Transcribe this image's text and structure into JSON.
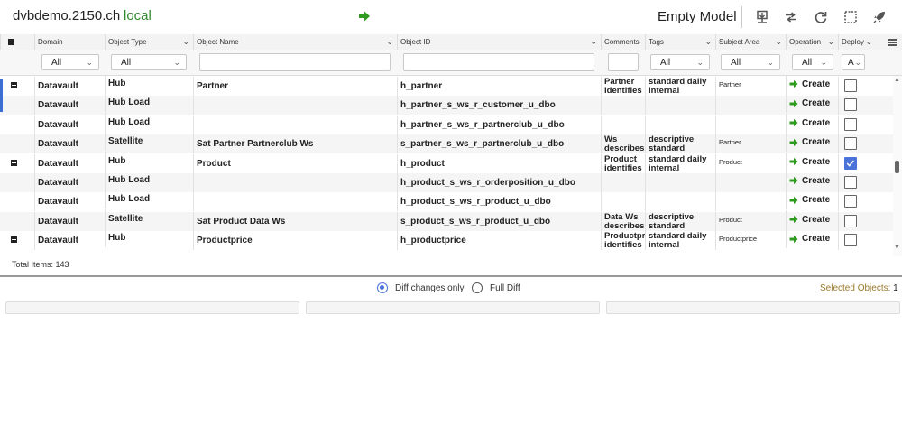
{
  "header": {
    "host": "dvbdemo.2150.ch",
    "environment": "local",
    "model": "Empty Model"
  },
  "colors": {
    "accent": "#4a73d9",
    "env_green": "#2e8b2e",
    "create_arrow": "#2e9a1f",
    "selected_label": "#9a7a2a"
  },
  "grid": {
    "columns": [
      "Domain",
      "Object Type",
      "Object Name",
      "Object ID",
      "Comments",
      "Tags",
      "Subject Area",
      "Operation",
      "Deploy"
    ],
    "filters": {
      "domain": "All",
      "object_type": "All",
      "object_name": "",
      "object_id": "",
      "comments": "",
      "tags": "All",
      "subject_area": "All",
      "operation": "All",
      "deploy": "A"
    },
    "rows": [
      {
        "expander": true,
        "domain": "Datavault",
        "object_type": "Hub",
        "object_name": "Partner",
        "object_id": "h_partner",
        "comments": "Partner identifies",
        "tags": "standard daily internal",
        "subject_area": "Partner",
        "operation": "Create",
        "deploy": false
      },
      {
        "expander": false,
        "domain": "Datavault",
        "object_type": "Hub Load",
        "object_name": "",
        "object_id": "h_partner_s_ws_r_customer_u_dbo",
        "comments": "",
        "tags": "",
        "subject_area": "",
        "operation": "Create",
        "deploy": false
      },
      {
        "expander": false,
        "domain": "Datavault",
        "object_type": "Hub Load",
        "object_name": "",
        "object_id": "h_partner_s_ws_r_partnerclub_u_dbo",
        "comments": "",
        "tags": "",
        "subject_area": "",
        "operation": "Create",
        "deploy": false
      },
      {
        "expander": false,
        "domain": "Datavault",
        "object_type": "Satellite",
        "object_name": "Sat Partner Partnerclub Ws",
        "object_id": "s_partner_s_ws_r_partnerclub_u_dbo",
        "comments": "Ws describes",
        "tags": "descriptive standard",
        "subject_area": "Partner",
        "operation": "Create",
        "deploy": false
      },
      {
        "expander": true,
        "domain": "Datavault",
        "object_type": "Hub",
        "object_name": "Product",
        "object_id": "h_product",
        "comments": "Product identifies",
        "tags": "standard daily internal",
        "subject_area": "Product",
        "operation": "Create",
        "deploy": true
      },
      {
        "expander": false,
        "domain": "Datavault",
        "object_type": "Hub Load",
        "object_name": "",
        "object_id": "h_product_s_ws_r_orderposition_u_dbo",
        "comments": "",
        "tags": "",
        "subject_area": "",
        "operation": "Create",
        "deploy": false
      },
      {
        "expander": false,
        "domain": "Datavault",
        "object_type": "Hub Load",
        "object_name": "",
        "object_id": "h_product_s_ws_r_product_u_dbo",
        "comments": "",
        "tags": "",
        "subject_area": "",
        "operation": "Create",
        "deploy": false
      },
      {
        "expander": false,
        "domain": "Datavault",
        "object_type": "Satellite",
        "object_name": "Sat Product Data Ws",
        "object_id": "s_product_s_ws_r_product_u_dbo",
        "comments": "Data Ws describes",
        "tags": "descriptive standard",
        "subject_area": "Product",
        "operation": "Create",
        "deploy": false
      },
      {
        "expander": true,
        "domain": "Datavault",
        "object_type": "Hub",
        "object_name": "Productprice",
        "object_id": "h_productprice",
        "comments": "Productpri identifies",
        "tags": "standard daily internal",
        "subject_area": "Productprice",
        "operation": "Create",
        "deploy": false
      }
    ],
    "total_items": "Total Items: 143"
  },
  "diff": {
    "diff_changes_only": "Diff changes only",
    "full_diff": "Full Diff",
    "selected_label": "Selected Objects:",
    "selected_count": "1"
  }
}
